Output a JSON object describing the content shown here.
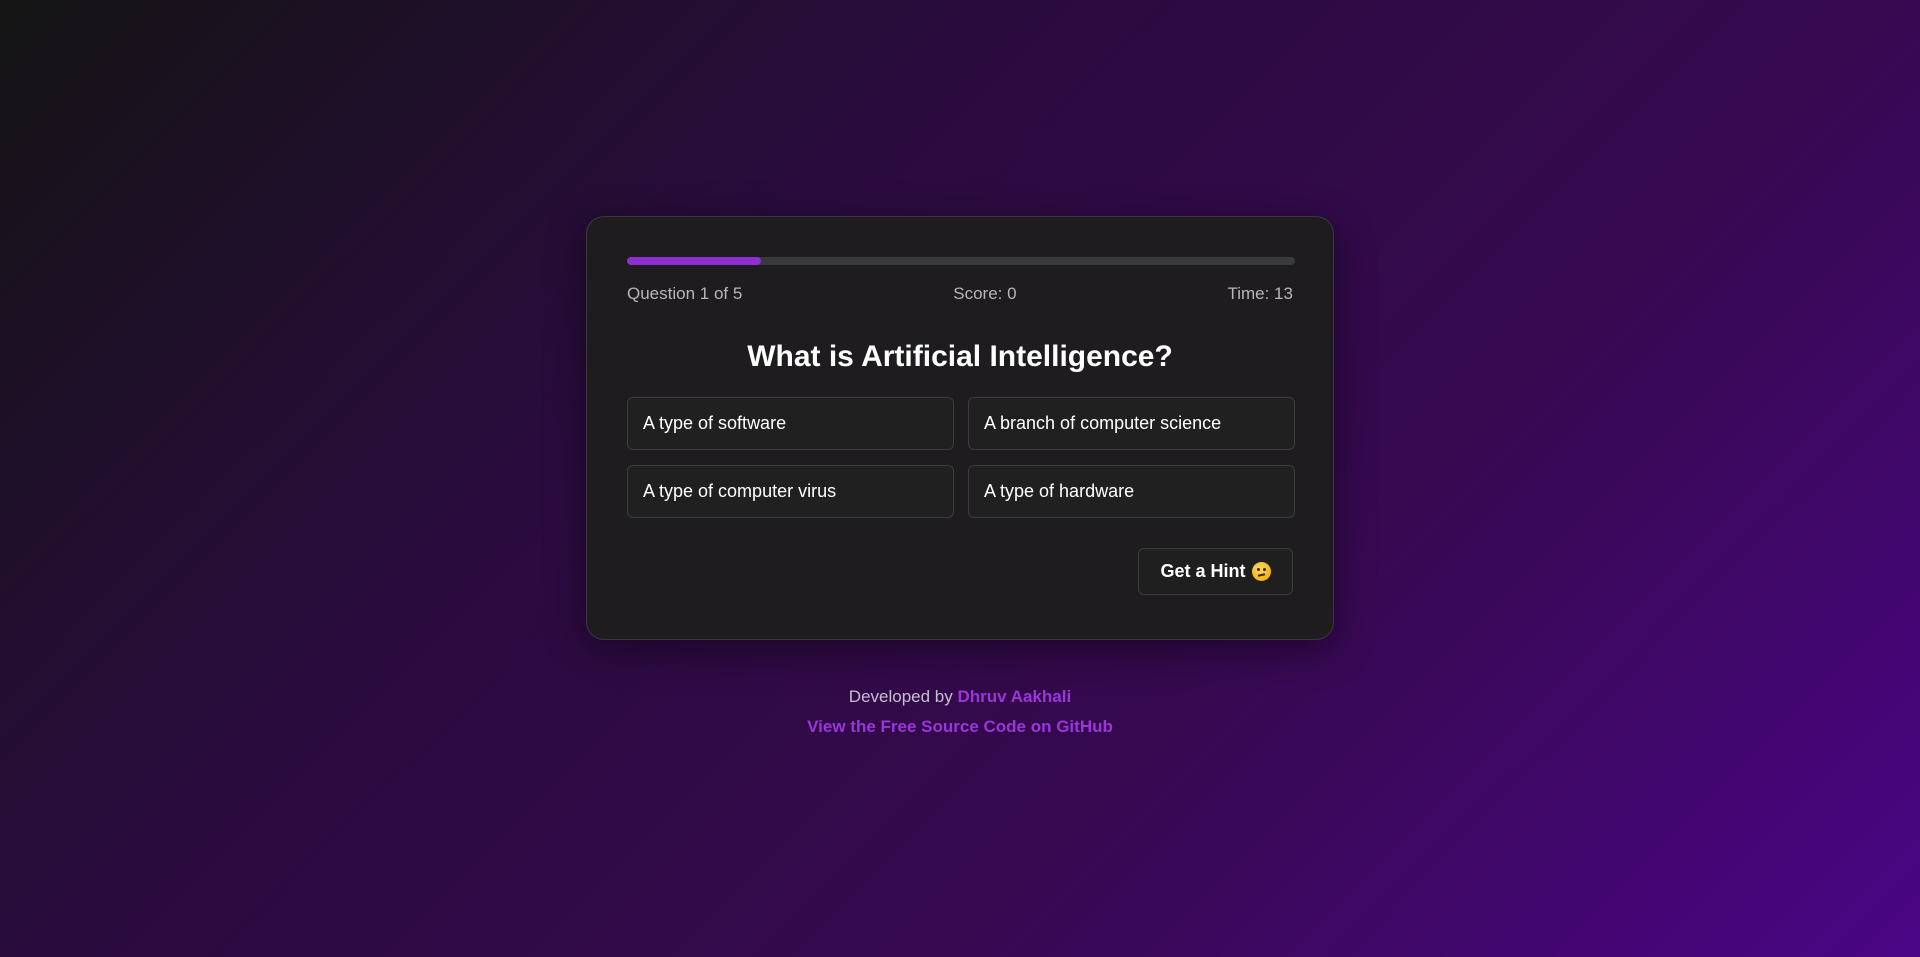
{
  "quiz": {
    "progress": {
      "current": 1,
      "total": 5,
      "fraction": 0.2
    },
    "question_counter": "Question 1 of 5",
    "score": "Score: 0",
    "timer": "Time: 13",
    "question": "What is Artificial Intelligence?",
    "answers": [
      {
        "label": "A type of software"
      },
      {
        "label": "A branch of computer science"
      },
      {
        "label": "A type of computer virus"
      },
      {
        "label": "A type of hardware"
      }
    ],
    "hint_button": {
      "label": "Get a Hint",
      "icon": "thinking-face-icon"
    }
  },
  "footer": {
    "developed_by": "Developed by",
    "author": "Dhruv Aakhali",
    "source_link": "View the Free Source Code on GitHub"
  },
  "colors": {
    "accent": "#8d2fd1",
    "link": "#9a35dc",
    "card_background": "#1e1c1f"
  }
}
